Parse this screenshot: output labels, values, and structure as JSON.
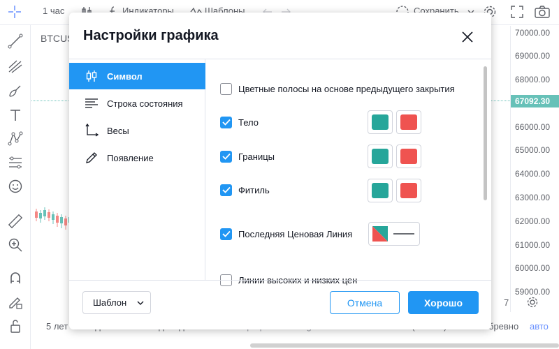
{
  "topbar": {
    "interval": "1 час",
    "indicators": "Индикаторы",
    "templates": "Шаблоны",
    "save": "Сохранить"
  },
  "chart": {
    "symbol": "BTCUS",
    "price_ticks": [
      "70000.00",
      "69000.00",
      "68000.00",
      "66000.00",
      "65000.00",
      "64000.00",
      "63000.00",
      "62000.00",
      "61000.00",
      "60000.00",
      "59000.00"
    ],
    "last_price": "67092.30",
    "accent_up": "#26a69a",
    "accent_down": "#ef5350"
  },
  "bottombar": {
    "ranges": [
      "5 лет",
      "1 год",
      "3м",
      "1м",
      "5д",
      "1д"
    ],
    "brand": "Графики TradingView",
    "time": "14:50:29 (UTC+3)",
    "percent": "%",
    "log": "бревно",
    "auto": "авто",
    "extra": "7"
  },
  "dialog": {
    "title": "Настройки графика",
    "nav": [
      {
        "label": "Символ",
        "icon": "candles-icon",
        "active": true
      },
      {
        "label": "Строка состояния",
        "icon": "status-line-icon",
        "active": false
      },
      {
        "label": "Весы",
        "icon": "scales-icon",
        "active": false
      },
      {
        "label": "Появление",
        "icon": "pencil-icon",
        "active": false
      }
    ],
    "options": {
      "prev_close": {
        "label": "Цветные полосы на основе предыдущего закрытия",
        "checked": false
      },
      "body": {
        "label": "Тело",
        "checked": true
      },
      "borders": {
        "label": "Границы",
        "checked": true
      },
      "wick": {
        "label": "Фитиль",
        "checked": true
      },
      "last_price_line": {
        "label": "Последняя Ценовая Линия",
        "checked": true
      },
      "high_low": {
        "label": "Линии высоких и низких цен",
        "checked": false
      }
    },
    "colors": {
      "up": "#26a69a",
      "down": "#ef5350",
      "primary": "#2196f3"
    },
    "footer": {
      "template": "Шаблон",
      "cancel": "Отмена",
      "ok": "Хорошо"
    }
  }
}
